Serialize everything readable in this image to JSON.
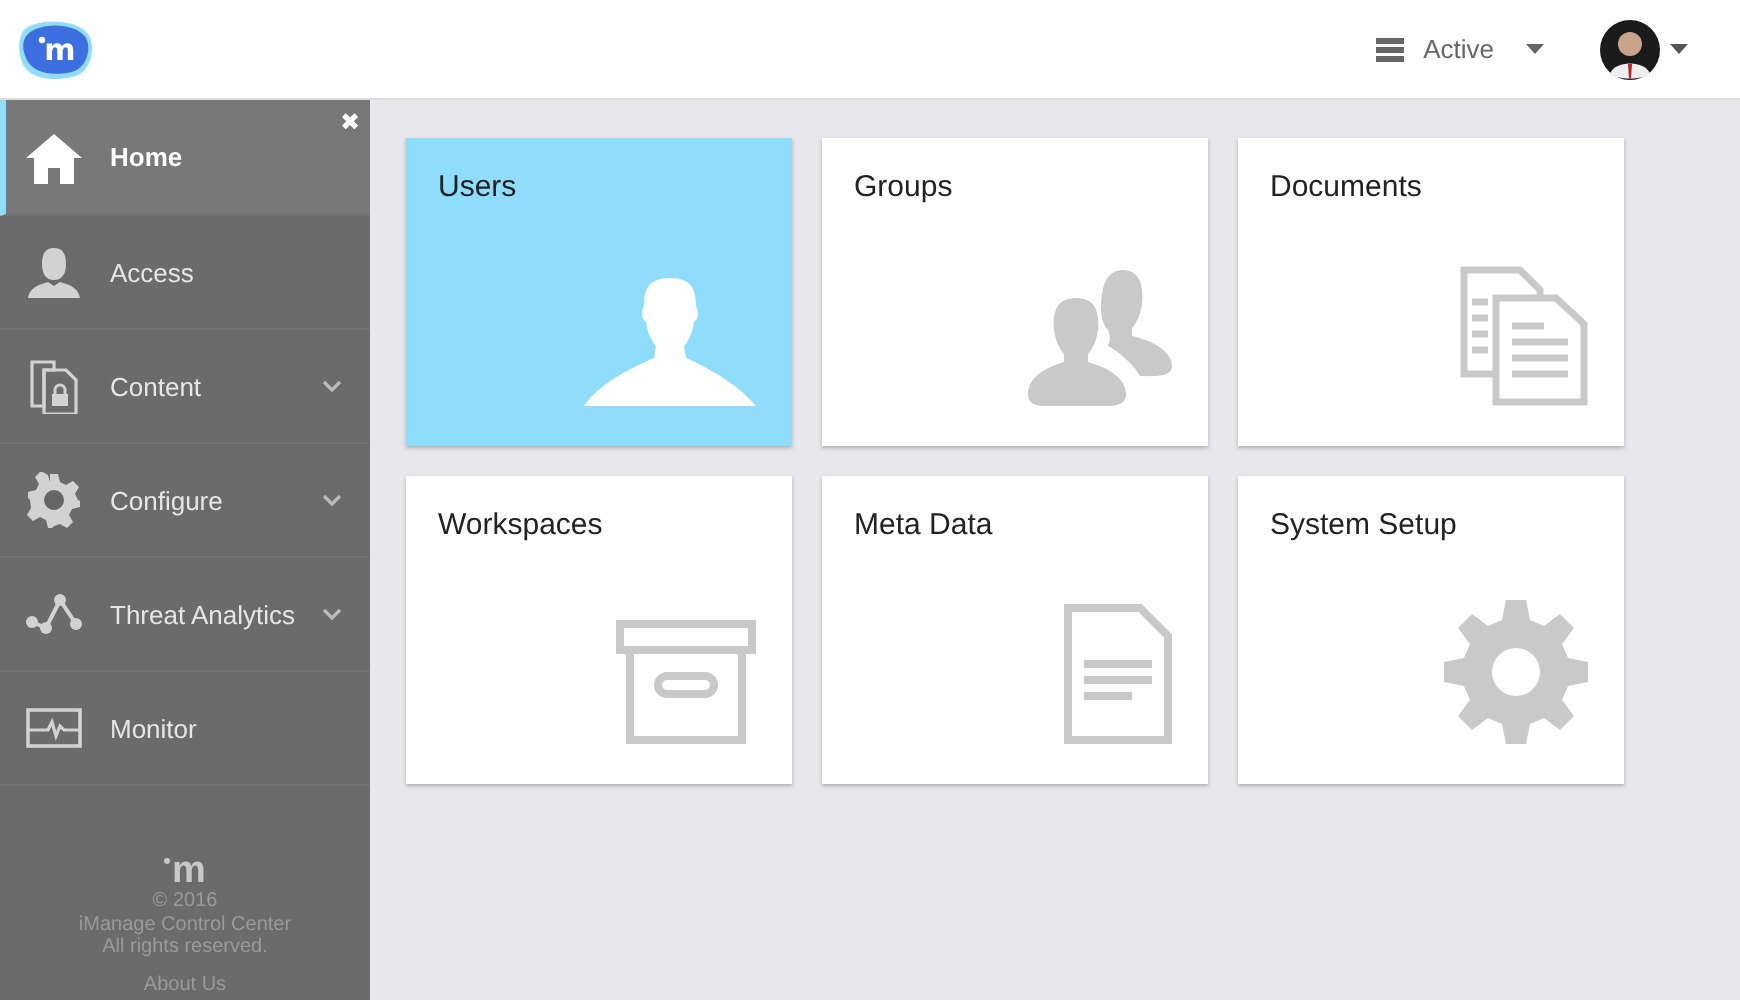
{
  "header": {
    "logo": {
      "letter": "m"
    },
    "status": {
      "label": "Active"
    }
  },
  "sidebar": {
    "close": "✖",
    "items": [
      {
        "label": "Home",
        "selected": true,
        "expandable": false
      },
      {
        "label": "Access",
        "selected": false,
        "expandable": false
      },
      {
        "label": "Content",
        "selected": false,
        "expandable": true
      },
      {
        "label": "Configure",
        "selected": false,
        "expandable": true
      },
      {
        "label": "Threat Analytics",
        "selected": false,
        "expandable": true
      },
      {
        "label": "Monitor",
        "selected": false,
        "expandable": false
      }
    ],
    "footer": {
      "logo": "m",
      "lines": [
        "© 2016",
        "iManage Control Center",
        "All rights reserved."
      ],
      "link": "About Us"
    }
  },
  "tiles": [
    {
      "title": "Users",
      "selected": true
    },
    {
      "title": "Groups",
      "selected": false
    },
    {
      "title": "Documents",
      "selected": false
    },
    {
      "title": "Workspaces",
      "selected": false
    },
    {
      "title": "Meta Data",
      "selected": false
    },
    {
      "title": "System Setup",
      "selected": false
    }
  ]
}
